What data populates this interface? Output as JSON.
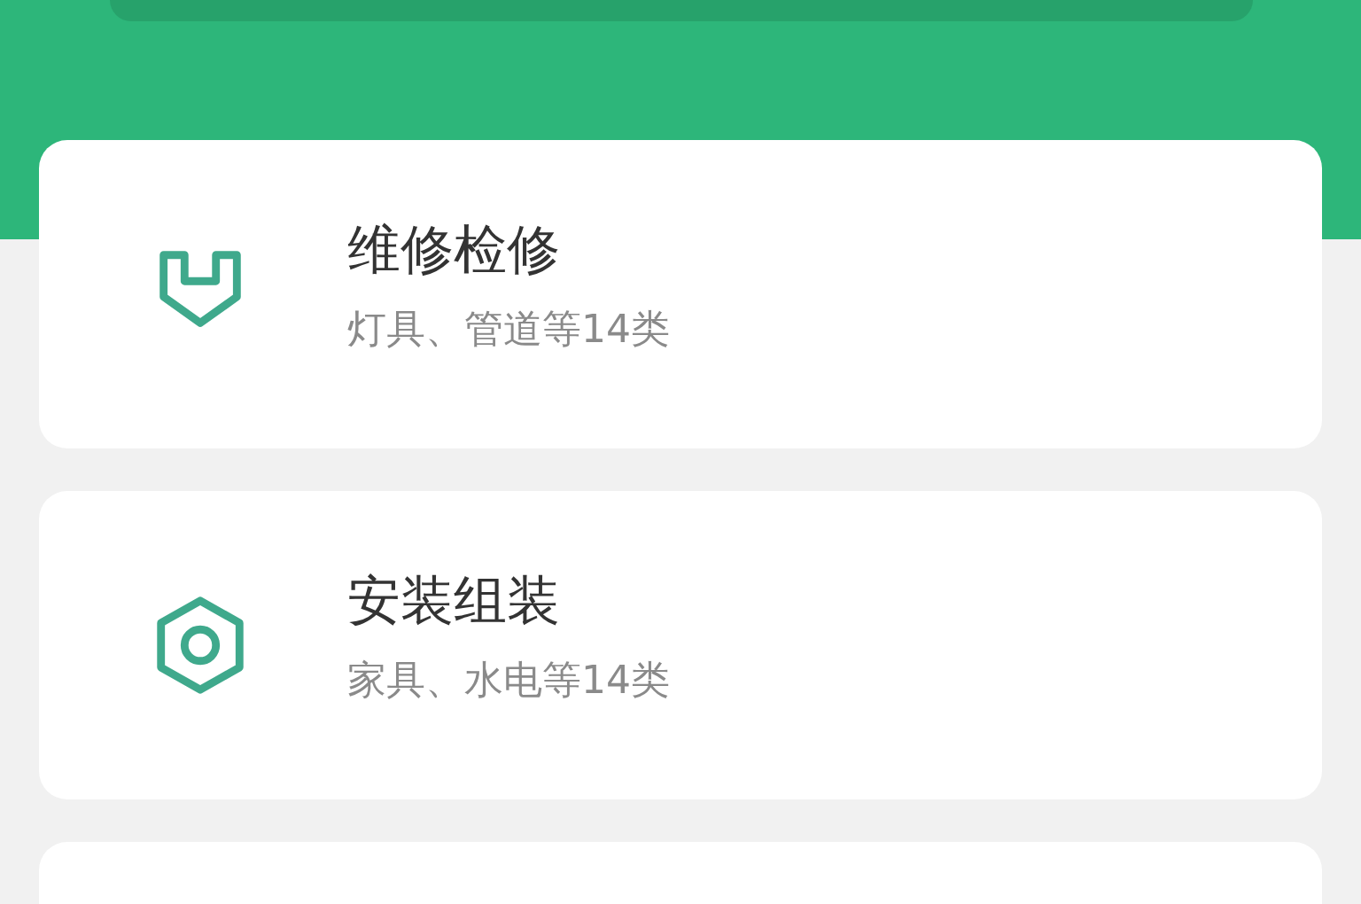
{
  "services": [
    {
      "kind": "repair",
      "title": "维修检修",
      "subtitle": "灯具、管道等14类"
    },
    {
      "kind": "install",
      "title": "安装组装",
      "subtitle": "家具、水电等14类"
    }
  ]
}
